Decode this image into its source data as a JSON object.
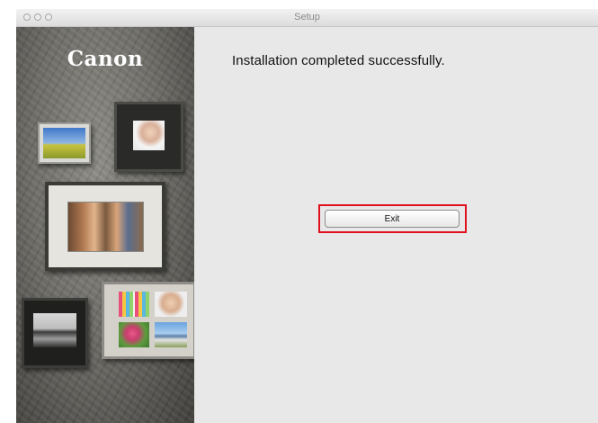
{
  "window": {
    "title": "Setup"
  },
  "sidebar": {
    "logo": "Canon"
  },
  "main": {
    "message": "Installation completed successfully.",
    "exit_label": "Exit"
  },
  "colors": {
    "highlight_border": "#e0101e",
    "window_background": "#e8e8e8"
  }
}
